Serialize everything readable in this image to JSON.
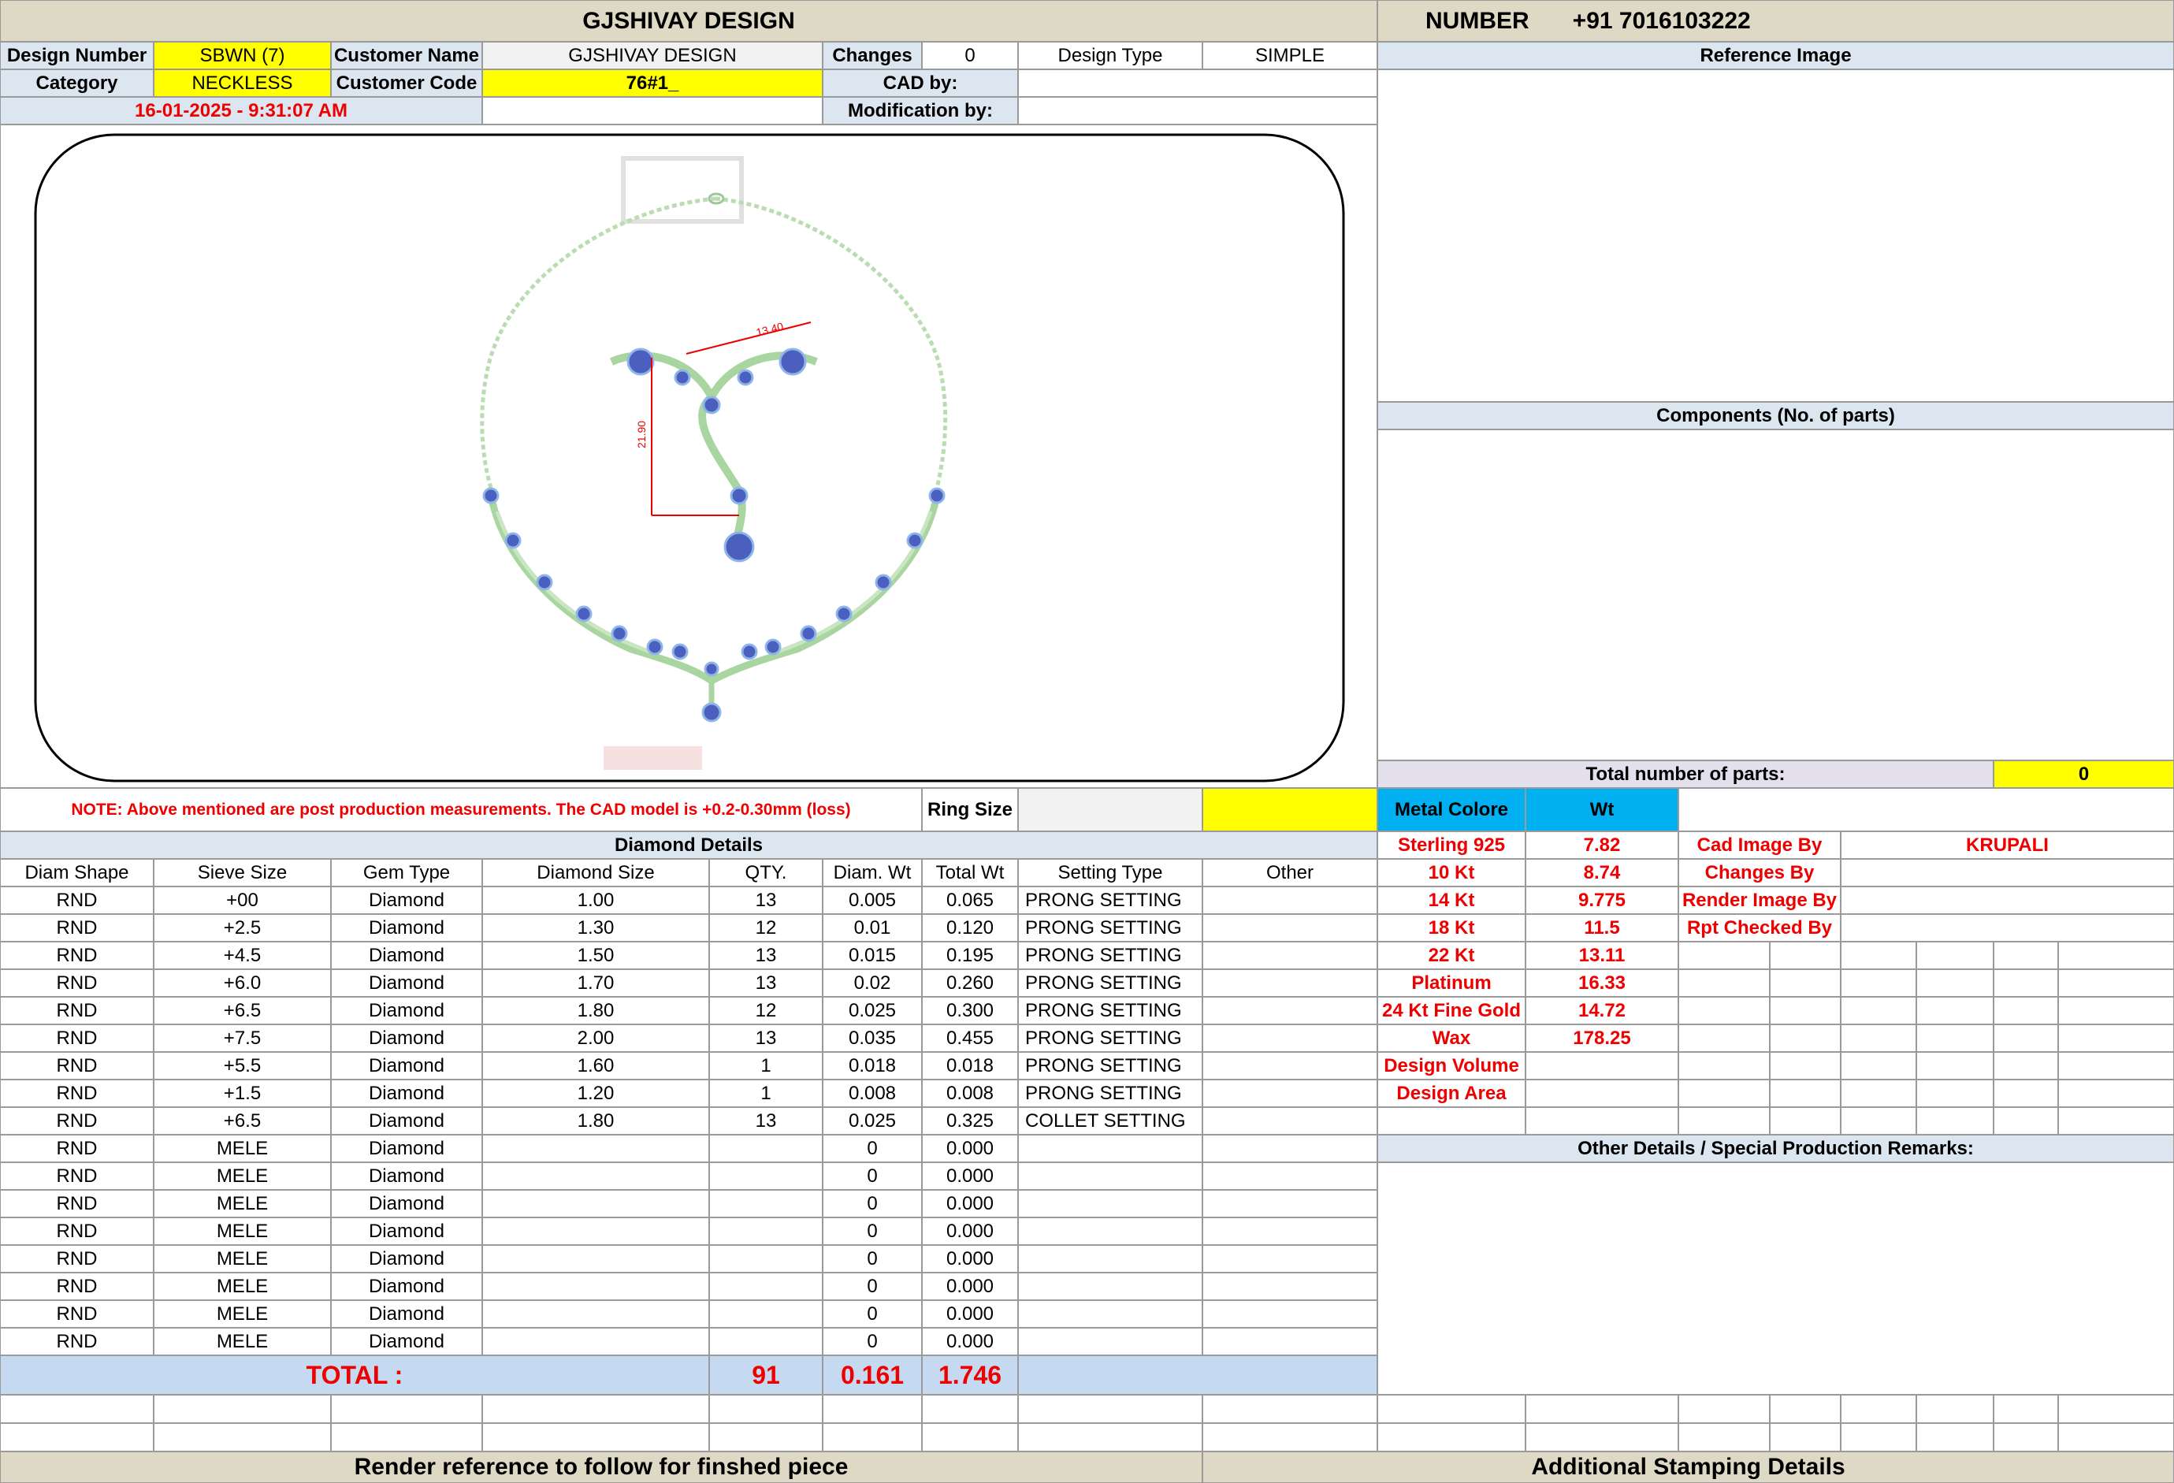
{
  "header": {
    "title": "GJSHIVAY DESIGN",
    "number_label": "NUMBER",
    "number_value": "+91 7016103222"
  },
  "info": {
    "design_number_label": "Design Number",
    "design_number_value": "SBWN (7)",
    "customer_name_label": "Customer Name",
    "customer_name_value": "GJSHIVAY DESIGN",
    "changes_label": "Changes",
    "changes_value": "0",
    "design_type_label": "Design Type",
    "design_type_value": "SIMPLE",
    "category_label": "Category",
    "category_value": "NECKLESS",
    "customer_code_label": "Customer Code",
    "customer_code_value": "76#1_",
    "cad_by_label": "CAD by:",
    "cad_by_value": "",
    "timestamp": "16-01-2025 - 9:31:07 AM",
    "modification_label": "Modification by:",
    "modification_value": ""
  },
  "drawing": {
    "dim_width": "13.40",
    "dim_height": "21.90"
  },
  "note": "NOTE: Above mentioned are post production measurements. The CAD model is +0.2-0.30mm (loss)",
  "ring_size_label": "Ring Size",
  "ring_size_value": "",
  "right_panel": {
    "reference_image_label": "Reference Image",
    "components_label": "Components (No. of parts)",
    "total_parts_label": "Total number of parts:",
    "total_parts_value": "0",
    "metal_colore_label": "Metal Colore",
    "wt_label": "Wt",
    "metals": [
      {
        "name": "Sterling 925",
        "wt": "7.82"
      },
      {
        "name": "10 Kt",
        "wt": "8.74"
      },
      {
        "name": "14 Kt",
        "wt": "9.775"
      },
      {
        "name": "18 Kt",
        "wt": "11.5"
      },
      {
        "name": "22 Kt",
        "wt": "13.11"
      },
      {
        "name": "Platinum",
        "wt": "16.33"
      },
      {
        "name": "24 Kt Fine Gold",
        "wt": "14.72"
      },
      {
        "name": "Wax",
        "wt": "178.25"
      },
      {
        "name": "Design Volume",
        "wt": ""
      },
      {
        "name": "Design Area",
        "wt": ""
      }
    ],
    "credits": [
      {
        "label": "Cad Image By",
        "value": "KRUPALI"
      },
      {
        "label": "Changes By",
        "value": ""
      },
      {
        "label": "Render Image By",
        "value": ""
      },
      {
        "label": "Rpt Checked By",
        "value": ""
      }
    ],
    "other_details_label": "Other Details / Special Production Remarks:"
  },
  "diamond_details": {
    "title": "Diamond Details",
    "columns": [
      "Diam Shape",
      "Sieve Size",
      "Gem Type",
      "Diamond Size",
      "QTY.",
      "Diam. Wt",
      "Total Wt",
      "Setting Type",
      "Other"
    ],
    "rows": [
      [
        "RND",
        "+00",
        "Diamond",
        "1.00",
        "13",
        "0.005",
        "0.065",
        "PRONG SETTING",
        ""
      ],
      [
        "RND",
        "+2.5",
        "Diamond",
        "1.30",
        "12",
        "0.01",
        "0.120",
        "PRONG SETTING",
        ""
      ],
      [
        "RND",
        "+4.5",
        "Diamond",
        "1.50",
        "13",
        "0.015",
        "0.195",
        "PRONG SETTING",
        ""
      ],
      [
        "RND",
        "+6.0",
        "Diamond",
        "1.70",
        "13",
        "0.02",
        "0.260",
        "PRONG SETTING",
        ""
      ],
      [
        "RND",
        "+6.5",
        "Diamond",
        "1.80",
        "12",
        "0.025",
        "0.300",
        "PRONG SETTING",
        ""
      ],
      [
        "RND",
        "+7.5",
        "Diamond",
        "2.00",
        "13",
        "0.035",
        "0.455",
        "PRONG SETTING",
        ""
      ],
      [
        "RND",
        "+5.5",
        "Diamond",
        "1.60",
        "1",
        "0.018",
        "0.018",
        "PRONG SETTING",
        ""
      ],
      [
        "RND",
        "+1.5",
        "Diamond",
        "1.20",
        "1",
        "0.008",
        "0.008",
        "PRONG SETTING",
        ""
      ],
      [
        "RND",
        "+6.5",
        "Diamond",
        "1.80",
        "13",
        "0.025",
        "0.325",
        "COLLET SETTING",
        ""
      ],
      [
        "RND",
        "MELE",
        "Diamond",
        "",
        "",
        "0",
        "0.000",
        "",
        ""
      ],
      [
        "RND",
        "MELE",
        "Diamond",
        "",
        "",
        "0",
        "0.000",
        "",
        ""
      ],
      [
        "RND",
        "MELE",
        "Diamond",
        "",
        "",
        "0",
        "0.000",
        "",
        ""
      ],
      [
        "RND",
        "MELE",
        "Diamond",
        "",
        "",
        "0",
        "0.000",
        "",
        ""
      ],
      [
        "RND",
        "MELE",
        "Diamond",
        "",
        "",
        "0",
        "0.000",
        "",
        ""
      ],
      [
        "RND",
        "MELE",
        "Diamond",
        "",
        "",
        "0",
        "0.000",
        "",
        ""
      ],
      [
        "RND",
        "MELE",
        "Diamond",
        "",
        "",
        "0",
        "0.000",
        "",
        ""
      ],
      [
        "RND",
        "MELE",
        "Diamond",
        "",
        "",
        "0",
        "0.000",
        "",
        ""
      ]
    ],
    "total_label": "TOTAL :",
    "total_qty": "91",
    "total_diam_wt": "0.161",
    "total_wt": "1.746"
  },
  "footer": {
    "render_reference": "Render reference to follow for finshed piece",
    "stamping_details": "Additional Stamping Details"
  }
}
